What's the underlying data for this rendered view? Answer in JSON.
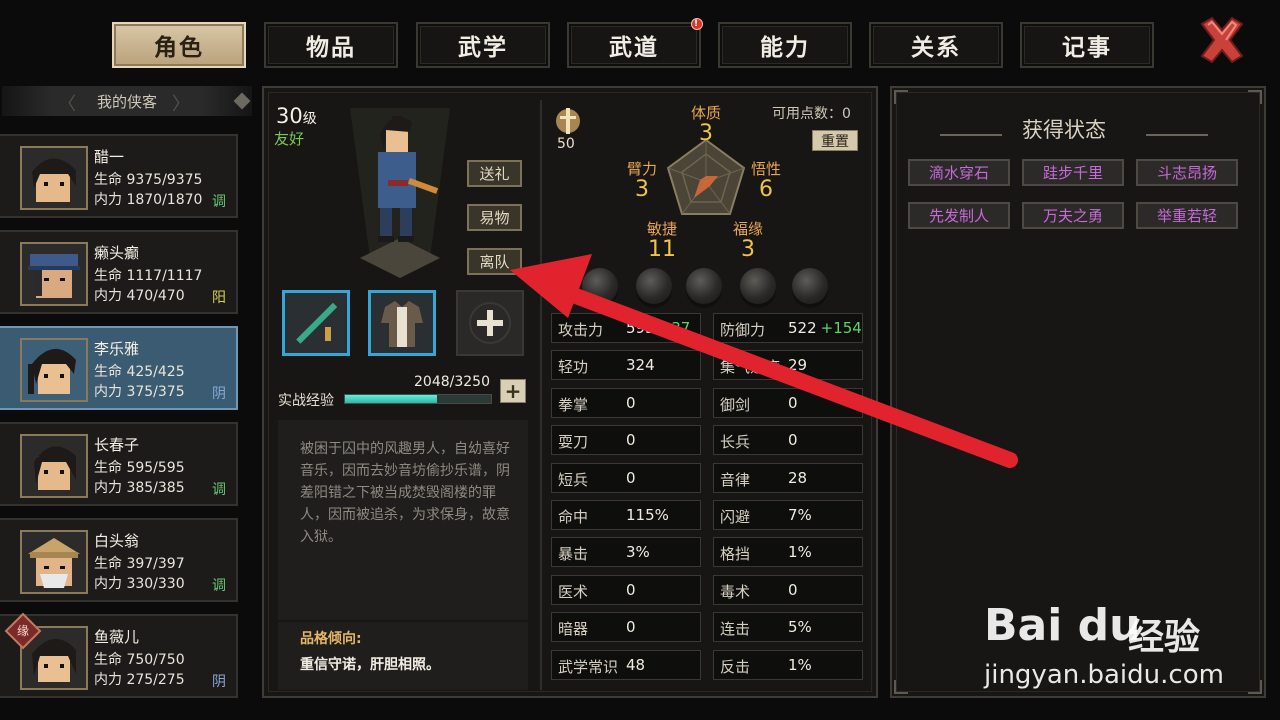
{
  "tabs": [
    {
      "label": "角色",
      "active": true
    },
    {
      "label": "物品"
    },
    {
      "label": "武学"
    },
    {
      "label": "武道",
      "alert": "!"
    },
    {
      "label": "能力"
    },
    {
      "label": "关系"
    },
    {
      "label": "记事"
    }
  ],
  "roster": {
    "header": "我的侠客",
    "members": [
      {
        "name": "醋一",
        "hp": "生命 9375/9375",
        "mp": "内力 1870/1870",
        "tag": "调"
      },
      {
        "name": "癞头癫",
        "hp": "生命 1117/1117",
        "mp": "内力 470/470",
        "tag": "阳"
      },
      {
        "name": "李乐雅",
        "hp": "生命 425/425",
        "mp": "内力 375/375",
        "tag": "阴"
      },
      {
        "name": "长春子",
        "hp": "生命 595/595",
        "mp": "内力 385/385",
        "tag": "调"
      },
      {
        "name": "白头翁",
        "hp": "生命 397/397",
        "mp": "内力 330/330",
        "tag": "调"
      },
      {
        "name": "鱼薇儿",
        "hp": "生命 750/750",
        "mp": "内力 275/275",
        "tag": "阴",
        "badge": "缘"
      }
    ]
  },
  "character": {
    "level": "30",
    "level_unit": "级",
    "attitude": "友好",
    "buttons": {
      "gift": "送礼",
      "trade": "易物",
      "leave": "离队"
    },
    "exp_label": "实战经验",
    "exp_value": "2048/3250",
    "exp_fraction": 0.63,
    "exp_plus": "+",
    "description": "被困于囚中的风趣男人，自幼喜好音乐，因而去妙音坊偷抄乐谱，阴差阳错之下被当成焚毁阁楼的罪人，因而被追杀，为求保身，故意入狱。",
    "trait_title": "品格倾向:",
    "trait_text": "重信守诺，肝胆相照。"
  },
  "attributes": {
    "fame": "50",
    "points_label": "可用点数：0",
    "reset": "重置",
    "items": [
      {
        "name": "体质",
        "value": "3"
      },
      {
        "name": "臂力",
        "value": "3"
      },
      {
        "name": "悟性",
        "value": "6"
      },
      {
        "name": "敏捷",
        "value": "11"
      },
      {
        "name": "福缘",
        "value": "3"
      }
    ]
  },
  "stats": [
    {
      "name": "攻击力",
      "value": "595",
      "bonus": "+37"
    },
    {
      "name": "防御力",
      "value": "522",
      "bonus": "+154"
    },
    {
      "name": "轻功",
      "value": "324"
    },
    {
      "name": "集气速度",
      "value": "29"
    },
    {
      "name": "拳掌",
      "value": "0"
    },
    {
      "name": "御剑",
      "value": "0"
    },
    {
      "name": "耍刀",
      "value": "0"
    },
    {
      "name": "长兵",
      "value": "0"
    },
    {
      "name": "短兵",
      "value": "0"
    },
    {
      "name": "音律",
      "value": "28"
    },
    {
      "name": "命中",
      "value": "115%"
    },
    {
      "name": "闪避",
      "value": "7%"
    },
    {
      "name": "暴击",
      "value": "3%"
    },
    {
      "name": "格挡",
      "value": "1%"
    },
    {
      "name": "医术",
      "value": "0"
    },
    {
      "name": "毒术",
      "value": "0"
    },
    {
      "name": "暗器",
      "value": "0"
    },
    {
      "name": "连击",
      "value": "5%"
    },
    {
      "name": "武学常识",
      "value": "48"
    },
    {
      "name": "反击",
      "value": "1%"
    }
  ],
  "status_panel": {
    "title": "获得状态",
    "chips": [
      "滴水穿石",
      "跬步千里",
      "斗志昂扬",
      "先发制人",
      "万夫之勇",
      "举重若轻"
    ]
  },
  "watermark": {
    "logo": "Bai du",
    "brand": "经验",
    "url": "jingyan.baidu.com"
  },
  "colors": {
    "accent_tab": "#d8c7a5",
    "active_member": "#3b5b72",
    "status_text": "#c56ad6",
    "arrow": "#e0232d"
  }
}
